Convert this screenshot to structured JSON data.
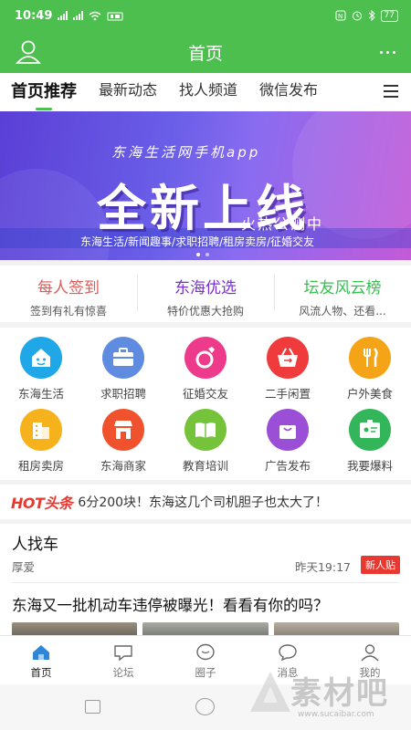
{
  "status_bar": {
    "time": "10:49",
    "battery": "77"
  },
  "header": {
    "title": "首页"
  },
  "tabs": [
    {
      "label": "首页推荐"
    },
    {
      "label": "最新动态"
    },
    {
      "label": "找人频道"
    },
    {
      "label": "微信发布"
    }
  ],
  "banner": {
    "subtitle": "东海生活网手机app",
    "headline": "全新上线",
    "tagline": "火热公测中",
    "features": "东海生活/新闻趣事/求职招聘/租房卖房/征婚交友"
  },
  "promos": [
    {
      "title": "每人签到",
      "subtitle": "签到有礼有惊喜",
      "color": "#e05a5a"
    },
    {
      "title": "东海优选",
      "subtitle": "特价优惠大抢购",
      "color": "#7a2ed6"
    },
    {
      "title": "坛友风云榜",
      "subtitle": "风流人物、还看...",
      "color": "#32c24d"
    }
  ],
  "grid": [
    {
      "label": "东海生活",
      "icon": "house-face-icon",
      "color": "#1fa7e8"
    },
    {
      "label": "求职招聘",
      "icon": "briefcase-icon",
      "color": "#5f8be0"
    },
    {
      "label": "征婚交友",
      "icon": "ring-icon",
      "color": "#ee3a8b"
    },
    {
      "label": "二手闲置",
      "icon": "basket-icon",
      "color": "#ef3b3b"
    },
    {
      "label": "户外美食",
      "icon": "fork-knife-icon",
      "color": "#f6a417"
    },
    {
      "label": "租房卖房",
      "icon": "building-icon",
      "color": "#f6b21c"
    },
    {
      "label": "东海商家",
      "icon": "storefront-icon",
      "color": "#f0522e"
    },
    {
      "label": "教育培训",
      "icon": "book-icon",
      "color": "#74c33a"
    },
    {
      "label": "广告发布",
      "icon": "bag-icon",
      "color": "#9b4fd6"
    },
    {
      "label": "我要爆料",
      "icon": "id-card-icon",
      "color": "#33b65a"
    }
  ],
  "headline": {
    "logo": "HOT头条",
    "text": "6分200块！东海这几个司机胆子也太大了！"
  },
  "feed": {
    "post1": {
      "title": "人找车",
      "author": "厚爱",
      "time": "昨天19:17",
      "badge": "新人贴"
    },
    "post2": {
      "title": "东海又一批机动车违停被曝光！看看有你的吗？"
    }
  },
  "bottom_nav": [
    {
      "label": "首页",
      "icon": "home-icon"
    },
    {
      "label": "论坛",
      "icon": "forum-icon"
    },
    {
      "label": "圈子",
      "icon": "circle-chat-icon"
    },
    {
      "label": "消息",
      "icon": "message-icon"
    },
    {
      "label": "我的",
      "icon": "profile-icon"
    }
  ],
  "watermark": {
    "text": "素材吧",
    "url": "www.sucaibar.com"
  },
  "colors": {
    "primary": "#4cbf4e",
    "hot_red": "#e8382f"
  }
}
